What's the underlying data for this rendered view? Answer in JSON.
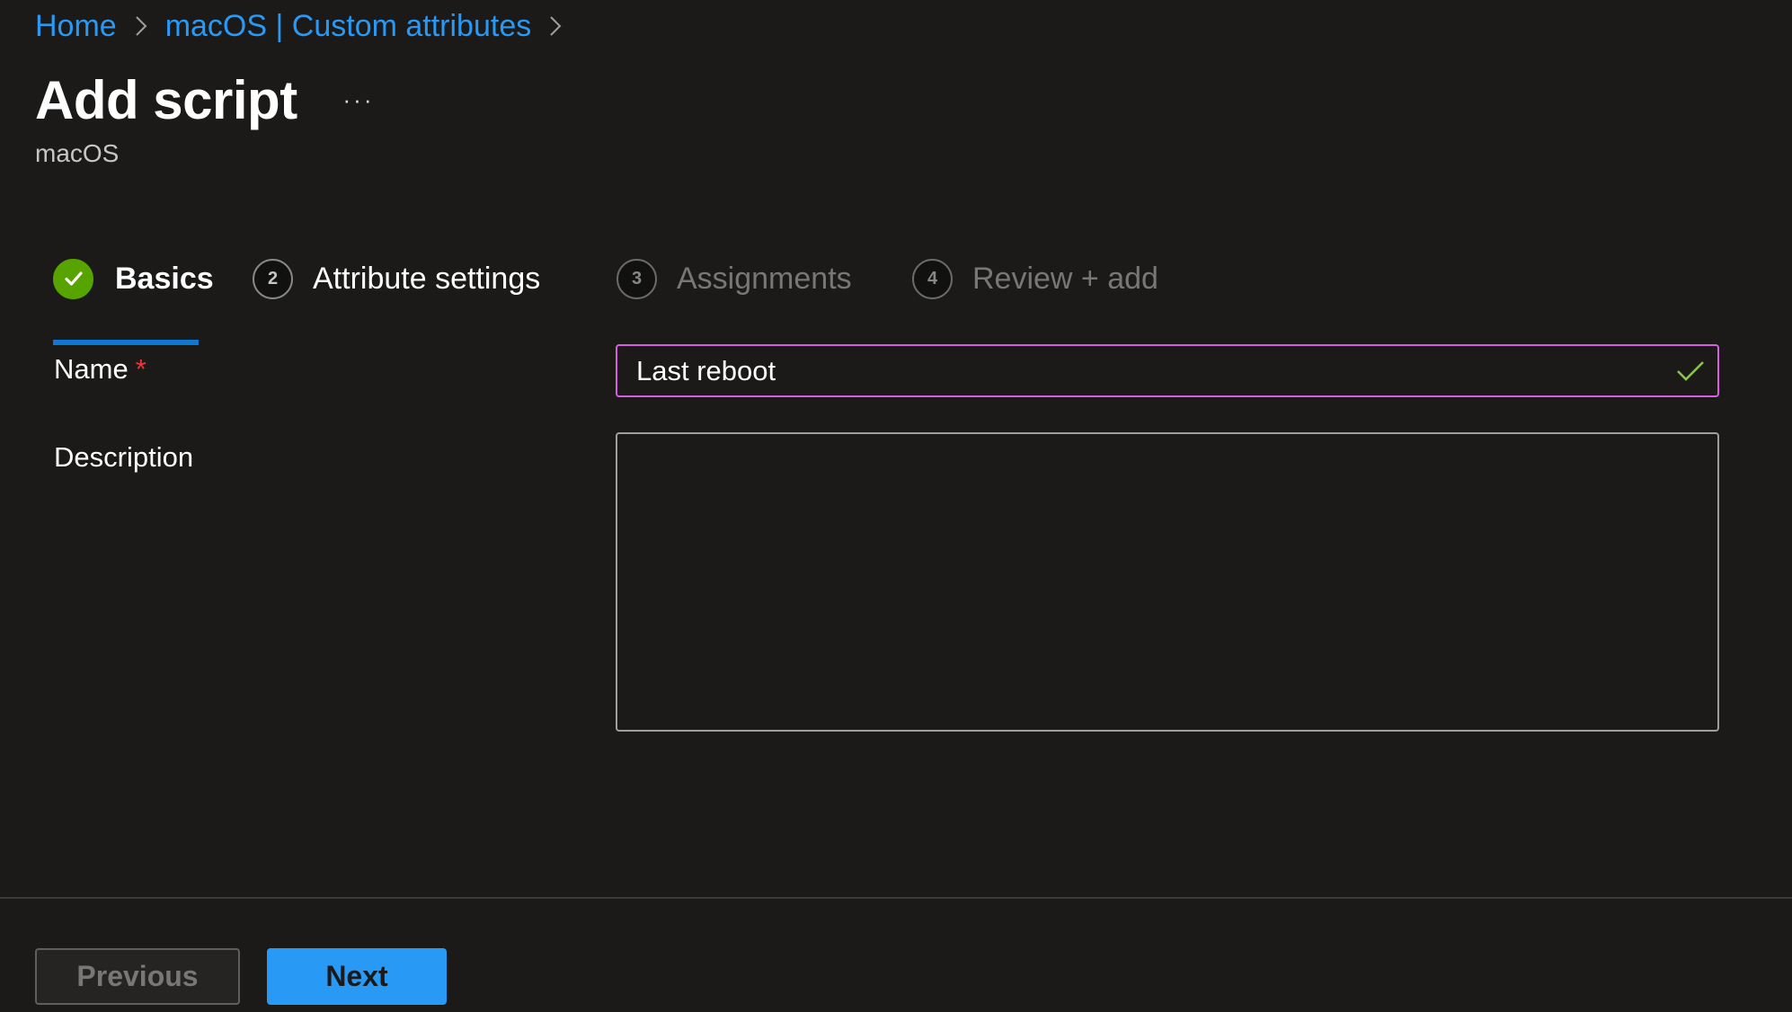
{
  "breadcrumb": {
    "items": [
      {
        "label": "Home"
      },
      {
        "label": "macOS | Custom attributes"
      }
    ]
  },
  "header": {
    "title": "Add script",
    "more_label": "···",
    "subtitle": "macOS"
  },
  "wizard": {
    "steps": [
      {
        "number": "1",
        "label": "Basics",
        "state": "completed-active"
      },
      {
        "number": "2",
        "label": "Attribute settings",
        "state": "enabled"
      },
      {
        "number": "3",
        "label": "Assignments",
        "state": "disabled"
      },
      {
        "number": "4",
        "label": "Review + add",
        "state": "disabled"
      }
    ]
  },
  "form": {
    "name": {
      "label": "Name",
      "required_marker": "*",
      "value": "Last reboot",
      "status": "valid"
    },
    "description": {
      "label": "Description",
      "value": ""
    }
  },
  "footer": {
    "previous_label": "Previous",
    "next_label": "Next"
  },
  "colors": {
    "accent": "#2899f5",
    "tab_underline": "#0f78d4",
    "success": "#57a300",
    "focus_border": "#d55fe1",
    "required": "#f1333a",
    "valid_check": "#8bc34a"
  }
}
